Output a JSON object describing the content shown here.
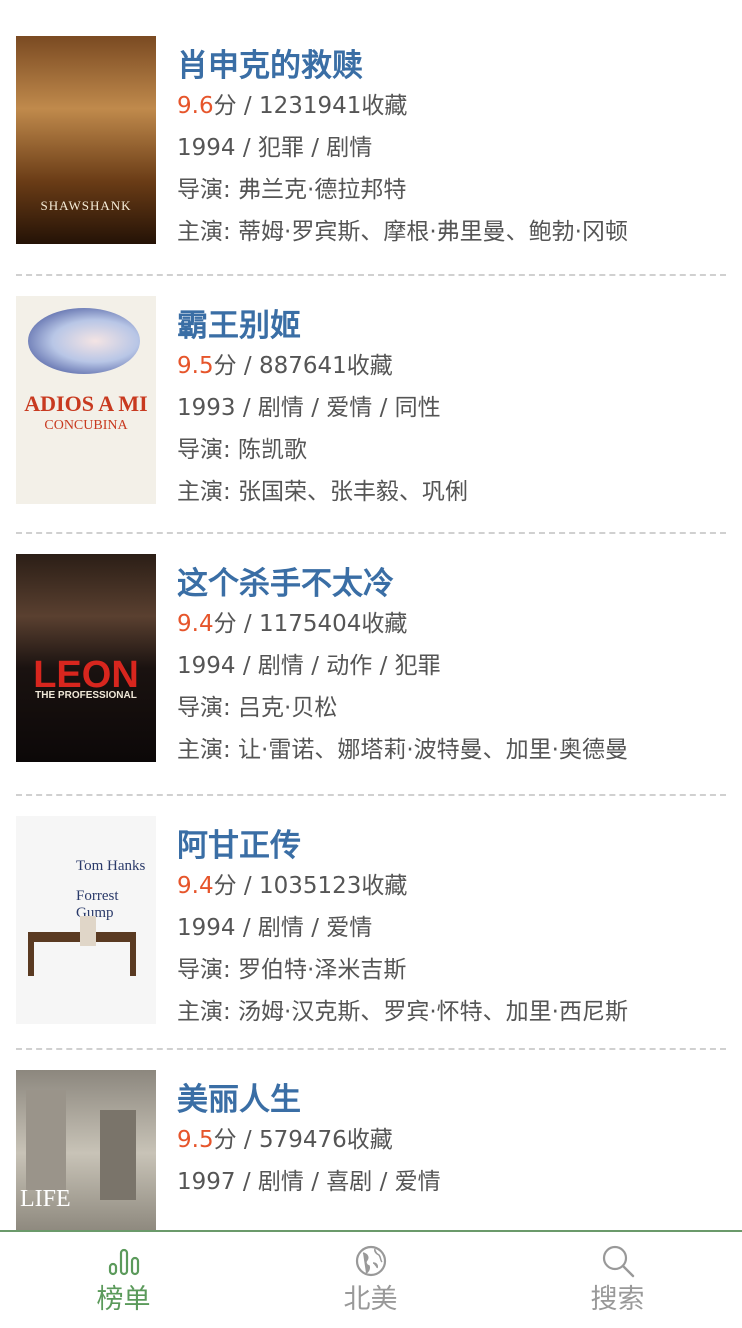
{
  "movies": [
    {
      "title": "肖申克的救赎",
      "rating": "9.6",
      "rating_suffix": "分 / 1231941收藏",
      "meta": "1994 / 犯罪 / 剧情",
      "director": "导演: 弗兰克·德拉邦特",
      "cast": "主演: 蒂姆·罗宾斯、摩根·弗里曼、鲍勃·冈顿",
      "poster_text": "SHAWSHANK"
    },
    {
      "title": "霸王别姬",
      "rating": "9.5",
      "rating_suffix": "分 / 887641收藏",
      "meta": "1993 / 剧情 / 爱情 / 同性",
      "director": "导演: 陈凯歌",
      "cast": "主演: 张国荣、张丰毅、巩俐",
      "poster_text": "ADIOS A MI",
      "poster_subtext": "CONCUBINA"
    },
    {
      "title": "这个杀手不太冷",
      "rating": "9.4",
      "rating_suffix": "分 / 1175404收藏",
      "meta": "1994 / 剧情 / 动作 / 犯罪",
      "director": "导演: 吕克·贝松",
      "cast": "主演: 让·雷诺、娜塔莉·波特曼、加里·奥德曼",
      "poster_text": "LEON",
      "poster_subtext": "THE PROFESSIONAL"
    },
    {
      "title": "阿甘正传",
      "rating": "9.4",
      "rating_suffix": "分 / 1035123收藏",
      "meta": "1994 / 剧情 / 爱情",
      "director": "导演: 罗伯特·泽米吉斯",
      "cast": "主演: 汤姆·汉克斯、罗宾·怀特、加里·西尼斯",
      "poster_text": "Tom Hanks",
      "poster_subtext": "Forrest Gump"
    },
    {
      "title": "美丽人生",
      "rating": "9.5",
      "rating_suffix": "分 / 579476收藏",
      "meta": "1997 / 剧情 / 喜剧 / 爱情",
      "director": "",
      "cast": "",
      "poster_text": "LIFE"
    }
  ],
  "tabs": [
    {
      "label": "榜单",
      "icon": "chart-icon",
      "active": true
    },
    {
      "label": "北美",
      "icon": "globe-icon",
      "active": false
    },
    {
      "label": "搜索",
      "icon": "search-icon",
      "active": false
    }
  ],
  "colors": {
    "title": "#3a6ea5",
    "rating": "#e6552b",
    "text": "#555555",
    "tab_active": "#5b9a5b",
    "tab_inactive": "#999999"
  }
}
